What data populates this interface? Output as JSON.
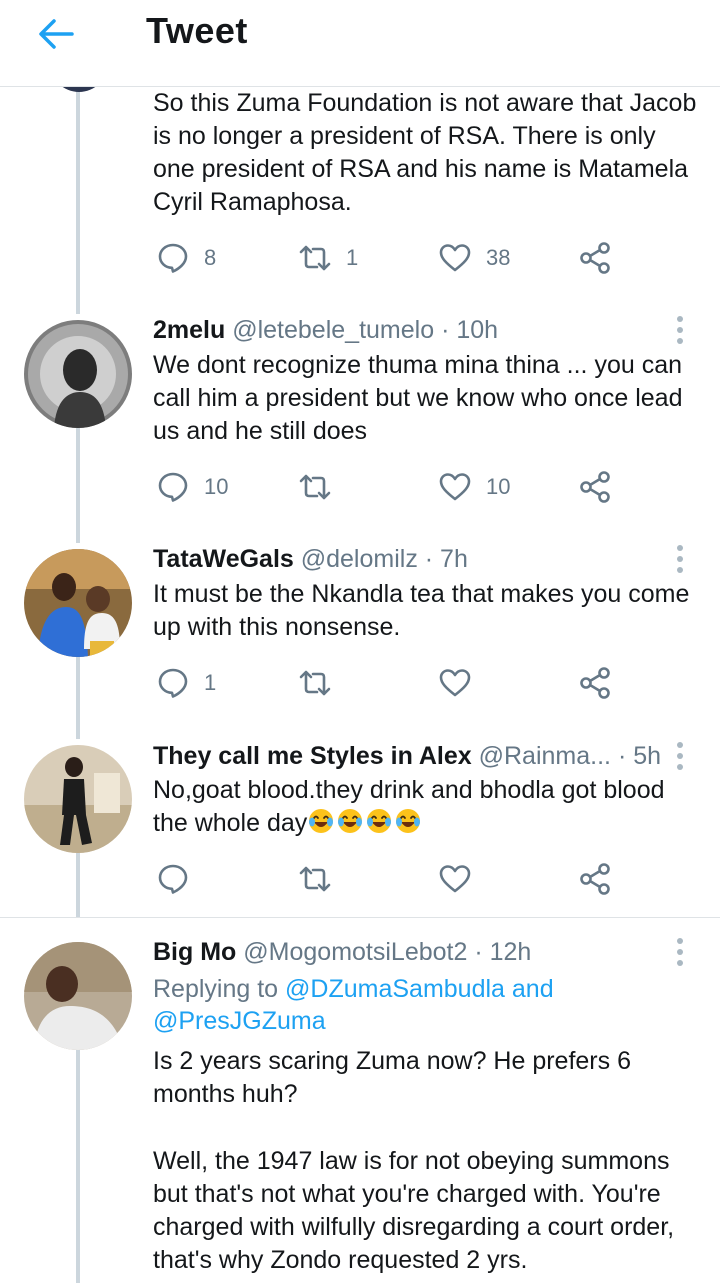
{
  "header": {
    "title": "Tweet"
  },
  "tweets": [
    {
      "text": "So this Zuma Foundation is not aware that Jacob is no longer a president of RSA. There is only one president of RSA and his name is Matamela Cyril Ramaphosa.",
      "replies": "8",
      "retweets": "1",
      "likes": "38"
    },
    {
      "name": "2melu",
      "handle": "@letebele_tumelo",
      "time": "· 10h",
      "text": "We dont recognize thuma mina thina ... you can call him a president but we know who once lead us and he still does",
      "replies": "10",
      "retweets": "",
      "likes": "10"
    },
    {
      "name": "TataWeGals",
      "handle": "@delomilz",
      "time": "· 7h",
      "text": "It must be the Nkandla tea that makes you come up with this nonsense.",
      "replies": "1",
      "retweets": "",
      "likes": ""
    },
    {
      "name": "They call me Styles in Alex",
      "handle": "@Rainma...",
      "time": "· 5h",
      "text_line1": "No,goat blood.they drink and bhodla got blood",
      "text_line2": "the whole day",
      "emojis": [
        "face-with-tears-of-joy",
        "face-with-tears-of-joy",
        "face-with-tears-of-joy",
        "face-with-tears-of-joy"
      ],
      "replies": "",
      "retweets": "",
      "likes": ""
    },
    {
      "name": "Big Mo",
      "handle": "@MogomotsiLebot2",
      "time": "· 12h",
      "replying_prefix": "Replying to ",
      "replying_user1": "@DZumaSambudla",
      "replying_and": " and",
      "replying_user2": "@PresJGZuma",
      "paragraph1": "Is 2 years scaring Zuma now? He prefers 6 months huh?",
      "paragraph2": "Well, the 1947  law is for not obeying summons but that's not what you're charged with. You're charged with wilfully disregarding a court order, that's why Zondo requested 2 yrs."
    }
  ],
  "colors": {
    "accent": "#1da1f2",
    "secondary": "#657786",
    "thread": "#ccd6dd"
  }
}
